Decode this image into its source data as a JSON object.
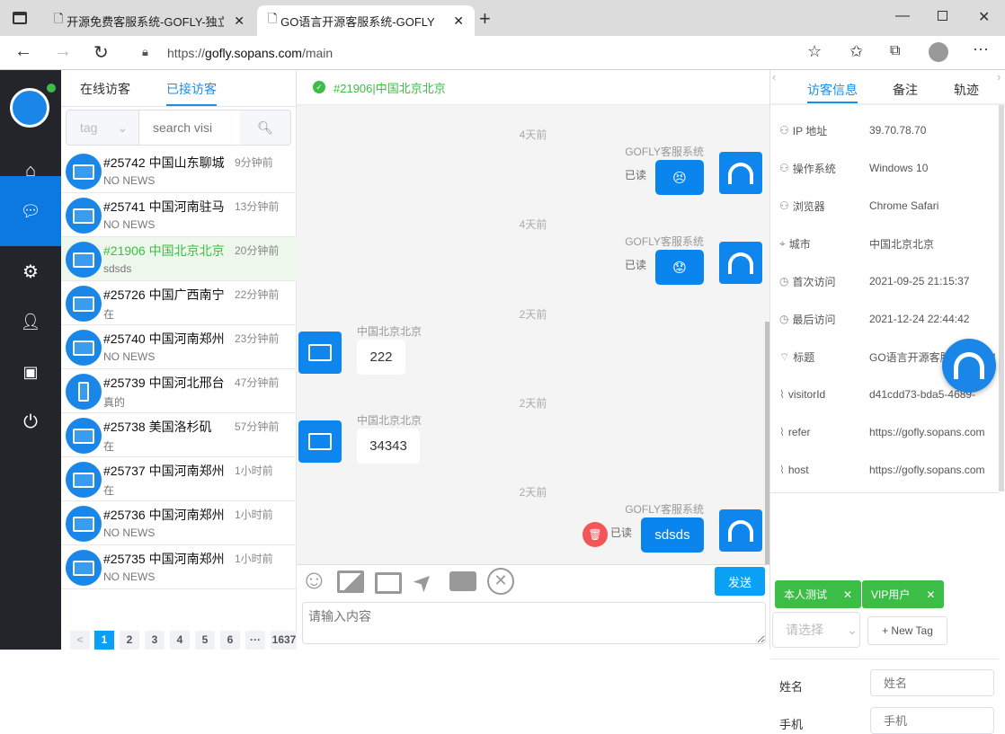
{
  "browser": {
    "tabs": [
      {
        "title": "开源免费客服系统-GOFLY-独立部"
      },
      {
        "title": "GO语言开源客服系统-GOFLY"
      }
    ],
    "url_prefix": "https://",
    "url_domain": "gofly.sopans.com",
    "url_path": "/main"
  },
  "sidebar": {
    "items": [
      "home",
      "chat",
      "settings",
      "user",
      "chip",
      "power"
    ],
    "active": "chat",
    "status_color": "#3cbd46"
  },
  "list": {
    "tabs": [
      "在线访客",
      "已接访客"
    ],
    "active_tab": "已接访客",
    "tag_placeholder": "tag",
    "search_placeholder": "search visi",
    "visitors": [
      {
        "title": "#25742 中国山东聊城",
        "time": "9分钟前",
        "last": "NO NEWS",
        "device": "desktop"
      },
      {
        "title": "#25741 中国河南驻马",
        "time": "13分钟前",
        "last": "NO NEWS",
        "device": "desktop"
      },
      {
        "title": "#21906 中国北京北京",
        "time": "20分钟前",
        "last": "sdsds",
        "device": "desktop",
        "selected": true
      },
      {
        "title": "#25726 中国广西南宁",
        "time": "22分钟前",
        "last": "在",
        "device": "desktop"
      },
      {
        "title": "#25740 中国河南郑州",
        "time": "23分钟前",
        "last": "NO NEWS",
        "device": "desktop"
      },
      {
        "title": "#25739 中国河北邢台",
        "time": "47分钟前",
        "last": "真的",
        "device": "mobile"
      },
      {
        "title": "#25738 美国洛杉矶",
        "time": "57分钟前",
        "last": "在",
        "device": "desktop"
      },
      {
        "title": "#25737 中国河南郑州",
        "time": "1小时前",
        "last": "在",
        "device": "desktop"
      },
      {
        "title": "#25736 中国河南郑州",
        "time": "1小时前",
        "last": "NO NEWS",
        "device": "desktop"
      },
      {
        "title": "#25735 中国河南郑州",
        "time": "1小时前",
        "last": "NO NEWS",
        "device": "desktop"
      }
    ],
    "pagination": {
      "prev": "<",
      "pages": [
        "1",
        "2",
        "3",
        "4",
        "5",
        "6",
        "···",
        "1637"
      ],
      "current": "1"
    }
  },
  "chat": {
    "header": "#21906|中国北京北京",
    "messages": [
      {
        "time": "4天前",
        "sender": "GOFLY客服系统",
        "from": "agent",
        "content": "😣",
        "status": "已读"
      },
      {
        "time": "4天前",
        "sender": "GOFLY客服系统",
        "from": "agent",
        "content": "😟",
        "status": "已读"
      },
      {
        "time": "2天前",
        "sender": "中国北京北京",
        "from": "visitor",
        "content": "222"
      },
      {
        "time": "2天前",
        "sender": "中国北京北京",
        "from": "visitor",
        "content": "34343"
      },
      {
        "time": "2天前",
        "sender": "GOFLY客服系统",
        "from": "agent",
        "content": "sdsds",
        "status": "已读"
      }
    ],
    "send_label": "发送",
    "input_placeholder": "请输入内容"
  },
  "info": {
    "tabs": [
      "访客信息",
      "备注",
      "轨迹"
    ],
    "active_tab": "访客信息",
    "fields": [
      {
        "icon": "user",
        "label": "IP 地址",
        "value": "39.70.78.70"
      },
      {
        "icon": "user",
        "label": "操作系统",
        "value": "Windows 10"
      },
      {
        "icon": "user",
        "label": "浏览器",
        "value": "Chrome Safari"
      },
      {
        "icon": "location",
        "label": "城市",
        "value": "中国北京北京"
      },
      {
        "icon": "clock",
        "label": "首次访问",
        "value": "2021-09-25 21:15:37"
      },
      {
        "icon": "clock",
        "label": "最后访问",
        "value": "2021-12-24 22:44:42"
      },
      {
        "icon": "title",
        "label": "标题",
        "value": "GO语言开源客服系统-GOFLY"
      },
      {
        "icon": "paperclip",
        "label": "visitorId",
        "value": "d41cdd73-bda5-4689-"
      },
      {
        "icon": "paperclip",
        "label": "refer",
        "value": "https://gofly.sopans.com"
      },
      {
        "icon": "paperclip",
        "label": "host",
        "value": "https://gofly.sopans.com"
      }
    ],
    "tags": [
      "本人测试",
      "VIP用户"
    ],
    "select_placeholder": "请选择",
    "new_tag": "+ New Tag",
    "name_label": "姓名",
    "name_placeholder": "姓名",
    "phone_label": "手机",
    "phone_placeholder": "手机"
  }
}
